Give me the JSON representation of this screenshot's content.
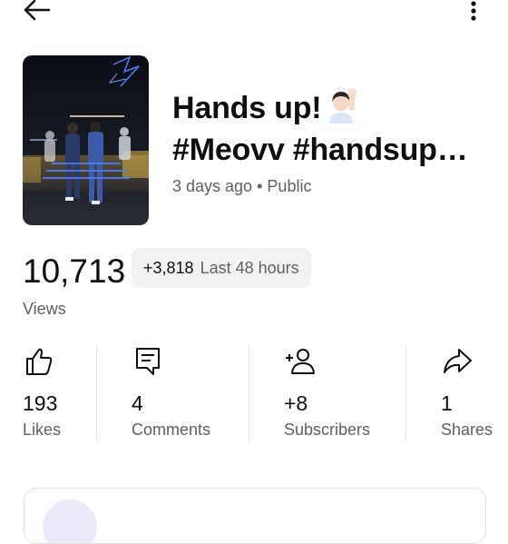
{
  "header": {
    "back_icon": "arrow-left-icon",
    "more_icon": "more-vert-icon"
  },
  "video": {
    "title_line1": "Hands up!",
    "title_line2": "#Meovv #handsup…",
    "title_emoji": "raising-hand-emoji",
    "age": "3 days ago",
    "separator": "•",
    "visibility": "Public"
  },
  "views": {
    "count": "10,713",
    "delta": "+3,818",
    "period": "Last 48 hours",
    "label": "Views"
  },
  "stats": [
    {
      "icon": "thumbs-up-icon",
      "value": "193",
      "label": "Likes"
    },
    {
      "icon": "comment-icon",
      "value": "4",
      "label": "Comments"
    },
    {
      "icon": "add-person-icon",
      "value": "+8",
      "label": "Subscribers"
    },
    {
      "icon": "share-icon",
      "value": "1",
      "label": "Shares"
    }
  ],
  "colors": {
    "primary_text": "#0f0f0f",
    "secondary_text": "#606060",
    "chip_bg": "#f2f2f2",
    "divider": "#e5e5e5"
  }
}
